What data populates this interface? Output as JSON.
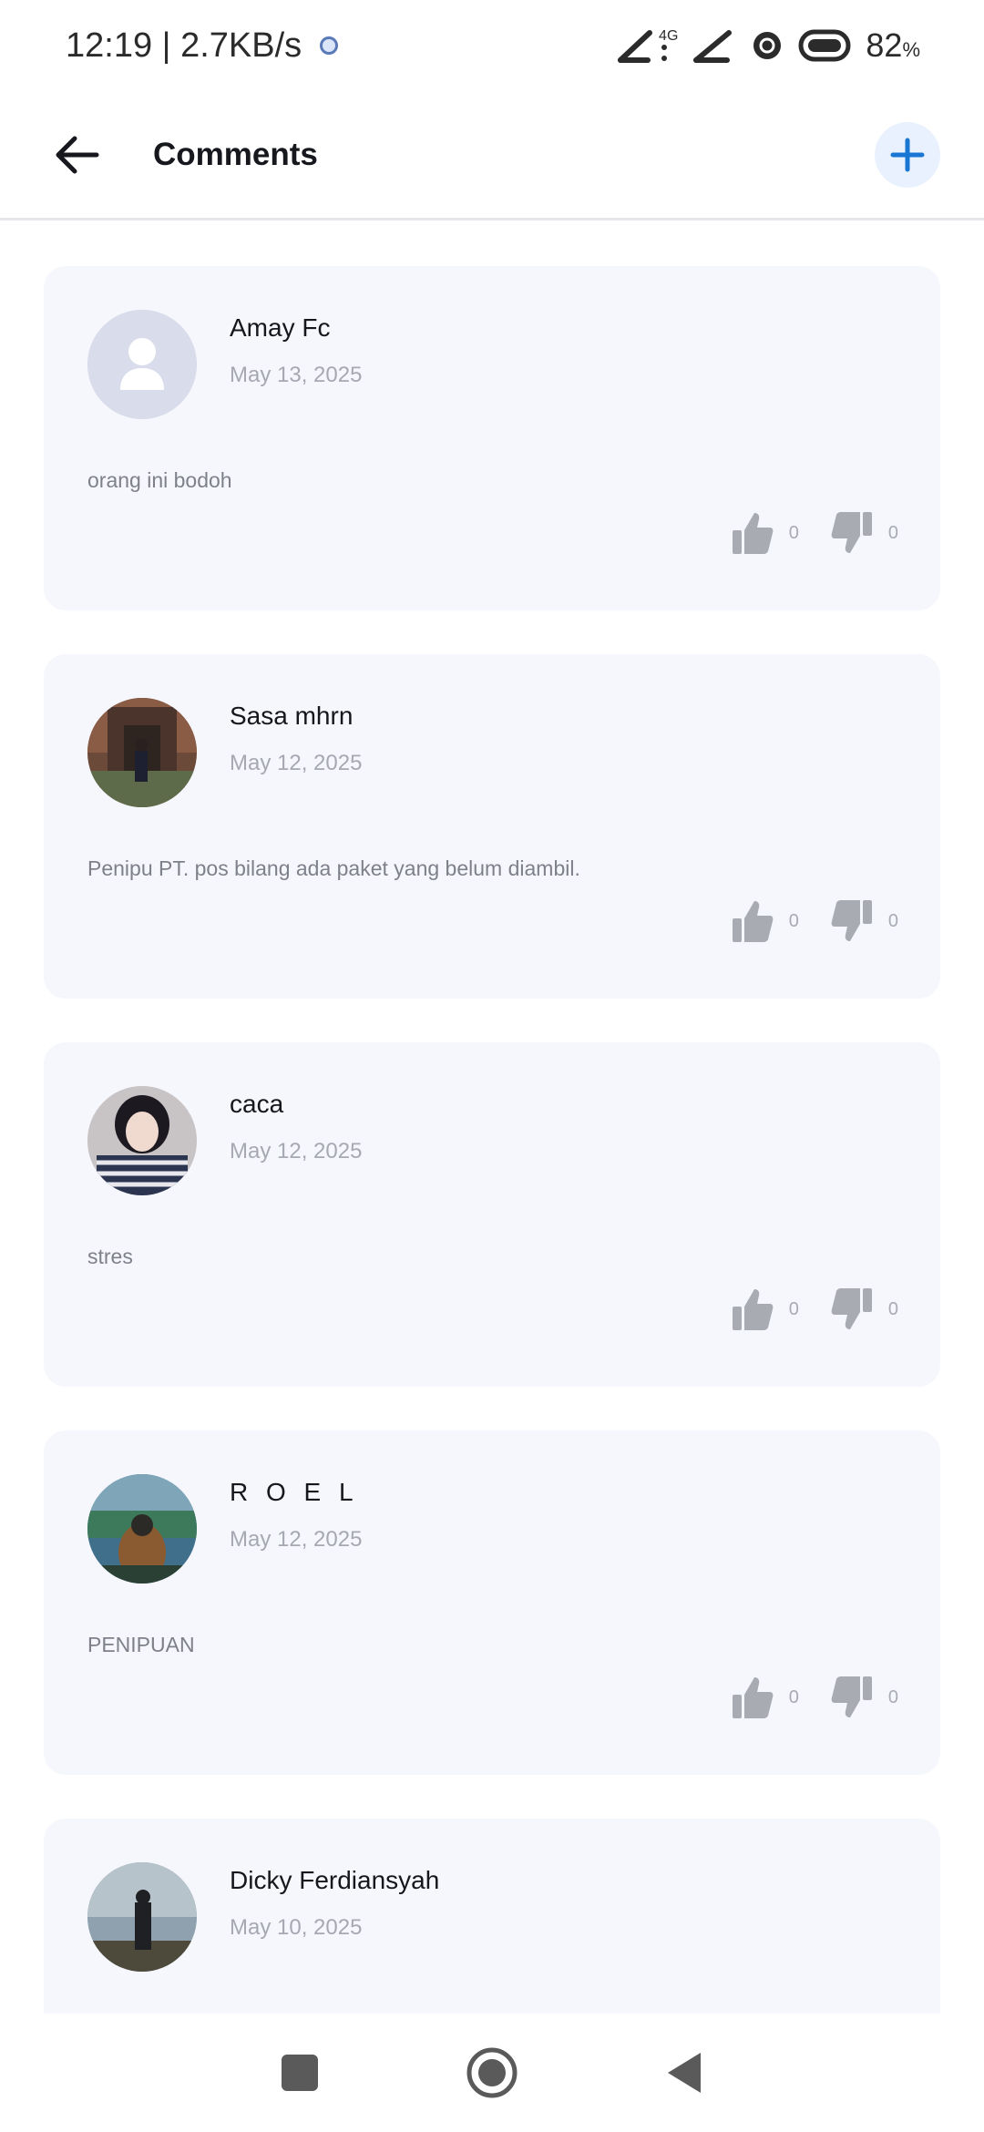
{
  "status": {
    "time_speed": "12:19 | 2.7KB/s",
    "network_label": "4G",
    "battery": "82",
    "battery_unit": "%"
  },
  "header": {
    "title": "Comments"
  },
  "colors": {
    "accent": "#1976d2",
    "card_bg": "#f6f7fc",
    "icon_gray": "#a9abb3"
  },
  "comments": [
    {
      "author": "Amay Fc",
      "date": "May 13, 2025",
      "text": "orang ini bodoh",
      "likes": "0",
      "dislikes": "0",
      "avatar": "default-person-icon"
    },
    {
      "author": "Sasa mhrn",
      "date": "May 12, 2025",
      "text": "Penipu PT. pos bilang ada paket yang belum diambil.",
      "likes": "0",
      "dislikes": "0",
      "avatar": "photo"
    },
    {
      "author": "caca",
      "date": "May 12, 2025",
      "text": "stres",
      "likes": "0",
      "dislikes": "0",
      "avatar": "photo"
    },
    {
      "author": "R O E L",
      "date": "May 12, 2025",
      "text": "PENIPUAN",
      "likes": "0",
      "dislikes": "0",
      "avatar": "photo"
    },
    {
      "author": "Dicky Ferdiansyah",
      "date": "May 10, 2025",
      "text": "",
      "likes": "",
      "dislikes": "",
      "avatar": "photo"
    }
  ]
}
